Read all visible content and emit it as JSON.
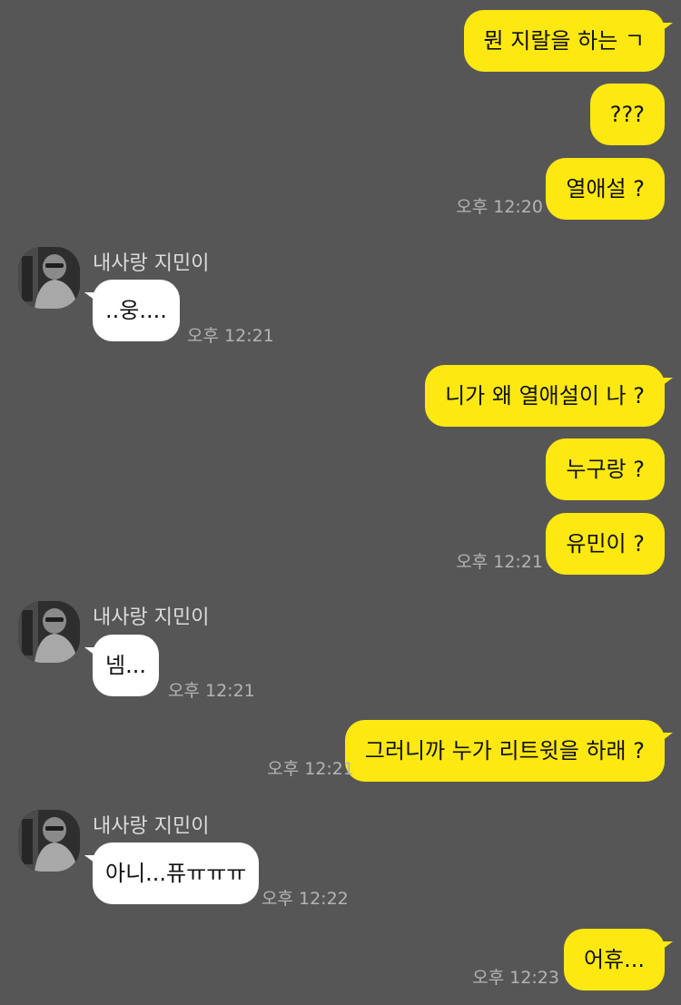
{
  "contact": {
    "name": "내사랑 지민이"
  },
  "messages": [
    {
      "text": "뭔 지랄을 하는 ㄱ"
    },
    {
      "text": "???"
    },
    {
      "text": "열애설 ?",
      "time": "오후 12:20"
    },
    {
      "text": "..웅....",
      "time": "오후 12:21"
    },
    {
      "text": "니가 왜 열애설이 나 ?"
    },
    {
      "text": "누구랑 ?"
    },
    {
      "text": "유민이 ?",
      "time": "오후 12:21"
    },
    {
      "text": "넴...",
      "time": "오후 12:21"
    },
    {
      "text": "그러니까 누가 리트윗을 하래 ?",
      "time": "오후 12:21"
    },
    {
      "text": "아니...퓨ㅠㅠㅠ",
      "time": "오후 12:22"
    },
    {
      "text": "어휴...",
      "time": "오후 12:23"
    }
  ],
  "colors": {
    "background": "#575657",
    "my_bubble": "#fde812",
    "their_bubble": "#ffffff",
    "timestamp": "#b4b4b4",
    "sender_name": "#dcdcdc"
  },
  "icons": {
    "avatar": "profile-photo-avatar"
  }
}
